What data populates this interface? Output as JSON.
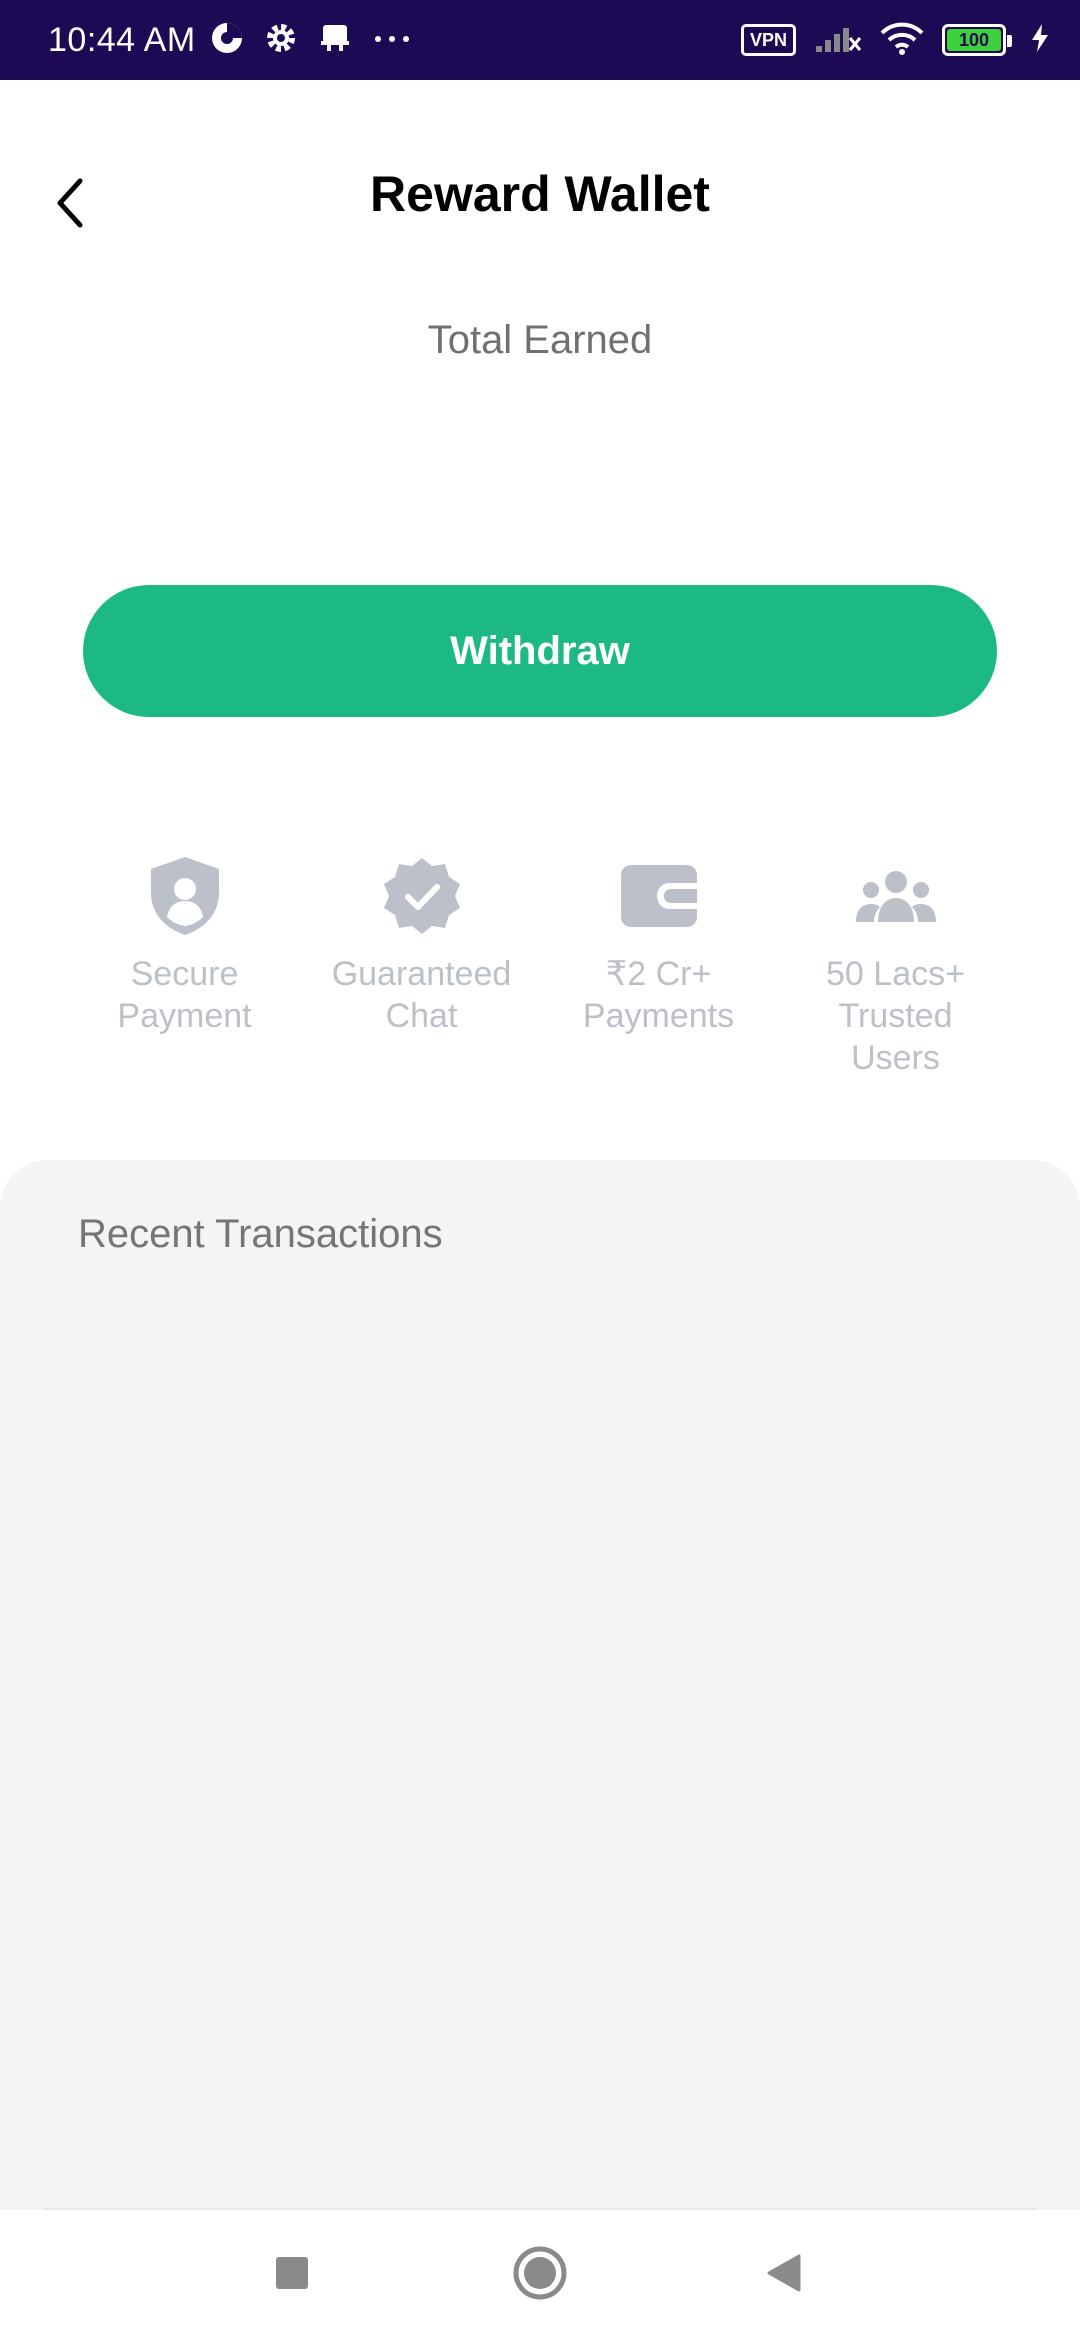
{
  "status_bar": {
    "time": "10:44 AM",
    "left_icons": [
      "data-saver-icon",
      "settings-icon",
      "notification-icon",
      "more-dots-icon"
    ],
    "vpn_label": "VPN",
    "battery_level": "100",
    "right_icons": [
      "signal-icon",
      "wifi-icon",
      "battery-icon",
      "charging-icon"
    ]
  },
  "header": {
    "back_icon": "chevron-left-icon",
    "title": "Reward Wallet"
  },
  "wallet": {
    "total_earned_label": "Total Earned",
    "withdraw_label": "Withdraw"
  },
  "features": [
    {
      "icon": "shield-user-icon",
      "label": "Secure\nPayment"
    },
    {
      "icon": "verified-badge-icon",
      "label": "Guaranteed\nChat"
    },
    {
      "icon": "wallet-icon",
      "label": "₹2 Cr+\nPayments"
    },
    {
      "icon": "users-group-icon",
      "label": "50 Lacs+\nTrusted\nUsers"
    }
  ],
  "transactions": {
    "title": "Recent Transactions",
    "items": []
  },
  "nav_bar": {
    "icons": [
      "recents-square-icon",
      "home-circle-icon",
      "back-triangle-icon"
    ]
  },
  "colors": {
    "status_bar_bg": "#1d0a55",
    "accent_green": "#1db985",
    "feature_gray": "#bcc0c8",
    "panel_bg": "#f3f4f6"
  }
}
